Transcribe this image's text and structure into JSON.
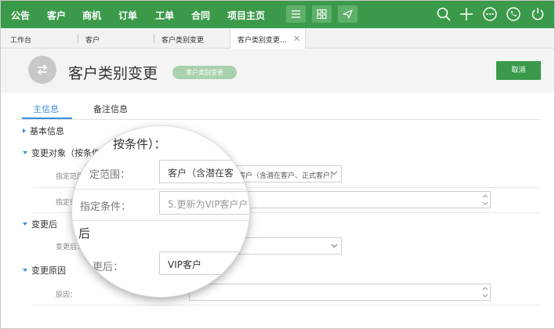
{
  "nav": {
    "items": [
      "公告",
      "客户",
      "商机",
      "订单",
      "工单",
      "合同",
      "项目主页"
    ]
  },
  "tabs": [
    "工作台",
    "客户",
    "客户类别变更",
    "客户类别变更..."
  ],
  "header": {
    "title": "客户类别变更",
    "badge": "客户类别变更",
    "cancel": "取消"
  },
  "subtabs": [
    "主信息",
    "备注信息"
  ],
  "sections": {
    "basic": "基本信息",
    "target": "变更对象（按条件）",
    "after": "变更后",
    "reason": "变更原因"
  },
  "fields": {
    "scope_label": "指定范围：",
    "scope_value": "客户（含潜在客户、正式客户）",
    "condition_label": "指定条件：",
    "condition_value": "5.更新为VIP客户户",
    "after_label": "变更后：",
    "after_value": "VIP客户",
    "reason_label": "原因："
  },
  "lens": {
    "title": "按条件）：",
    "scope_label": "定范围：",
    "scope_value": "客户（含潜在客",
    "condition_label": "指定条件：",
    "condition_value": "5.更新为VIP客户户",
    "after_header": "后",
    "after_label": "更后：",
    "after_value": "VIP客户"
  },
  "colors": {
    "brand_green": "#3b9a4a",
    "accent_blue": "#3b8fd9"
  }
}
